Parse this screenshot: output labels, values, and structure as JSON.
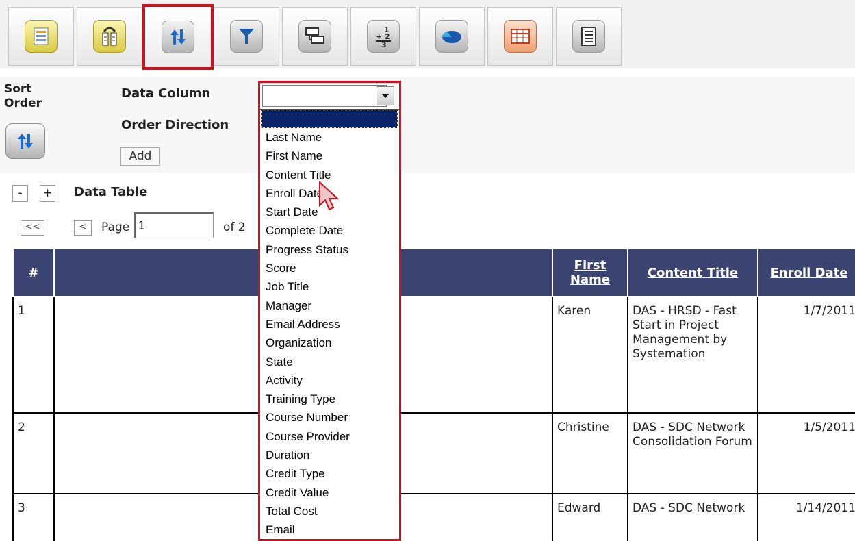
{
  "toolbar": {
    "icons": [
      "select-report-icon",
      "groups-icon",
      "sort-order-icon",
      "filter-icon",
      "layout-icon",
      "numbering-icon",
      "chart-icon",
      "table-icon",
      "summary-icon"
    ],
    "active": "sort-order-icon",
    "accent_color": "#c8141e"
  },
  "sort_panel": {
    "title": "Sort\nOrder",
    "data_column_label": "Data Column",
    "order_direction_label": "Order Direction",
    "add_label": "Add",
    "selected_value": ""
  },
  "dropdown": {
    "options": [
      "Last Name",
      "First Name",
      "Content Title",
      "Enroll Date",
      "Start Date",
      "Complete Date",
      "Progress Status",
      "Score",
      "Job Title",
      "Manager",
      "Email Address",
      "Organization",
      "State",
      "Activity",
      "Training Type",
      "Course Number",
      "Course Provider",
      "Duration",
      "Credit Type",
      "Credit Value",
      "Total Cost",
      "Email"
    ]
  },
  "data_table": {
    "collapse": "-",
    "expand": "+",
    "title": "Data Table",
    "pager": {
      "first": "<<",
      "prev": "<",
      "page_label": "Page",
      "page_value": "1",
      "of_label": "of 2"
    },
    "columns": {
      "num": "#",
      "first_name": "First Name",
      "content_title": "Content Title",
      "enroll_date": "Enroll Date"
    },
    "header_color": "#3b4471",
    "rows": [
      {
        "num": "1",
        "first_name": "Karen",
        "content_title": "DAS - HRSD - Fast Start in Project Management by Systemation",
        "enroll_date": "1/7/2011"
      },
      {
        "num": "2",
        "first_name": "Christine",
        "content_title": "DAS - SDC Network Consolidation Forum",
        "enroll_date": "1/5/2011"
      },
      {
        "num": "3",
        "first_name": "Edward",
        "content_title": "DAS - SDC Network",
        "enroll_date": "1/14/2011"
      }
    ]
  }
}
